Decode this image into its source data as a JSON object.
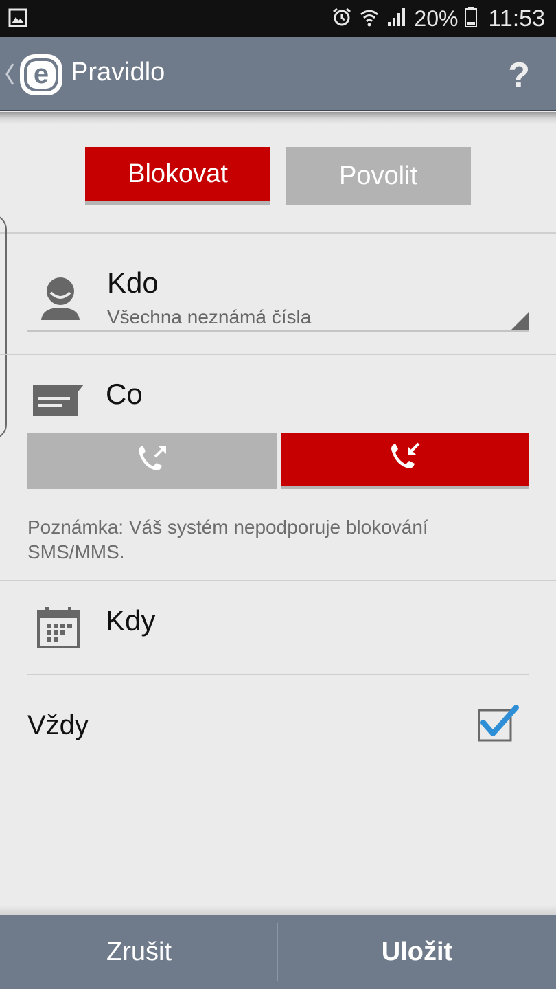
{
  "status_bar": {
    "icons": [
      "image-icon",
      "alarm-icon",
      "wifi-icon",
      "signal-icon",
      "battery-icon"
    ],
    "battery": "20%",
    "time": "11:53"
  },
  "app_bar": {
    "title": "Pravidlo",
    "help": "?",
    "color": "#6f7b8a"
  },
  "action_toggle": {
    "block_label": "Blokovat",
    "allow_label": "Povolit",
    "selected": "block",
    "accent_color": "#c60000"
  },
  "who": {
    "title": "Kdo",
    "value": "Všechna neznámá čísla"
  },
  "what": {
    "title": "Co",
    "outgoing_icon": "phone-outgoing-icon",
    "incoming_icon": "phone-incoming-icon",
    "selected": "incoming",
    "note": "Poznámka: Váš systém nepodporuje blokování SMS/MMS."
  },
  "when": {
    "title": "Kdy",
    "always_label": "Vždy",
    "always_checked": true
  },
  "footer": {
    "cancel_label": "Zrušit",
    "save_label": "Uložit"
  }
}
